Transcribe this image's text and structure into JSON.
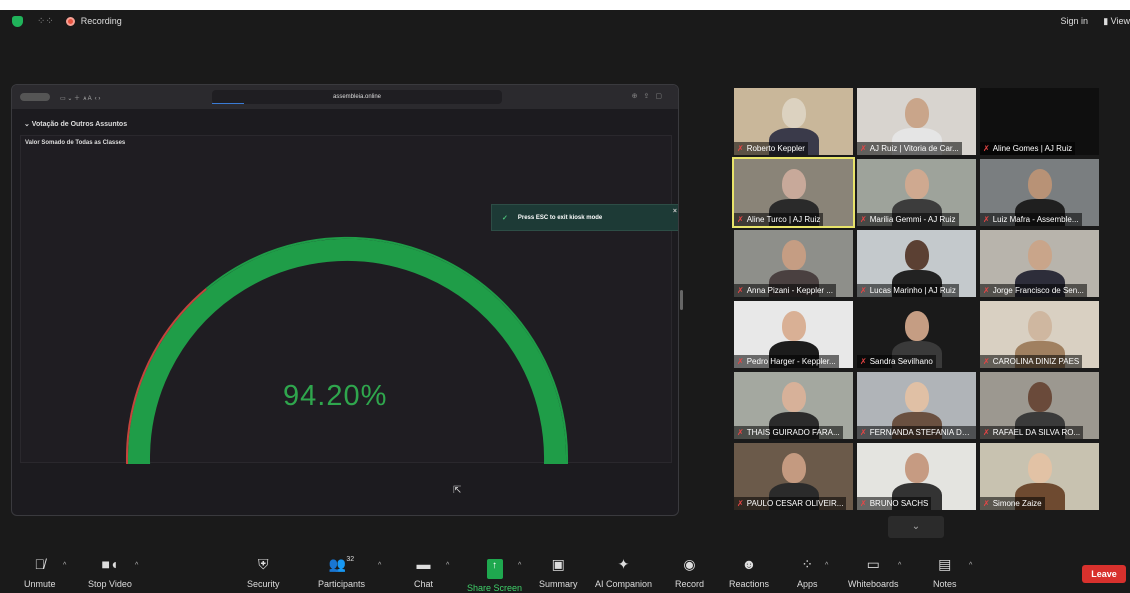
{
  "top": {
    "recording_label": "Recording",
    "sign_in": "Sign in",
    "view": "View"
  },
  "browser": {
    "url": "assembleia.online"
  },
  "share": {
    "section_title": "⌄ Votação de Outros Assuntos",
    "panel_title": "Valor Somado de Todas as Classes",
    "gauge_value_text": "94.20%",
    "gauge_fraction": 0.942,
    "gauge_green": "#1f9d48",
    "gauge_red": "#c5443c",
    "toast_text": "Press ESC to exit kiosk mode"
  },
  "participants": [
    {
      "name": "Roberto Keppler"
    },
    {
      "name": "AJ Ruiz | Vitoria de Car..."
    },
    {
      "name": "Aline Gomes | AJ Ruiz"
    },
    {
      "name": "Aline Turco | AJ Ruiz"
    },
    {
      "name": "Marilia Gemmi - AJ Ruiz"
    },
    {
      "name": "Luiz Mafra - Assemble..."
    },
    {
      "name": "Anna Pizani - Keppler ..."
    },
    {
      "name": "Lucas Marinho | AJ Ruiz"
    },
    {
      "name": "Jorge Francisco de Sen..."
    },
    {
      "name": "Pedro Harger - Keppler..."
    },
    {
      "name": "Sandra Sevilhano"
    },
    {
      "name": "CAROLINA DINIZ PAES"
    },
    {
      "name": "THAIS GUIRADO FARA..."
    },
    {
      "name": "FERNANDA STEFANIA DE..."
    },
    {
      "name": "RAFAEL DA SILVA RO..."
    },
    {
      "name": "PAULO CESAR OLIVEIR..."
    },
    {
      "name": "BRUNO SACHS"
    },
    {
      "name": "Simone Zaize"
    }
  ],
  "toolbar": {
    "unmute": "Unmute",
    "stop_video": "Stop Video",
    "security": "Security",
    "participants": "Participants",
    "participants_count": "32",
    "chat": "Chat",
    "share_screen": "Share Screen",
    "summary": "Summary",
    "ai_companion": "AI Companion",
    "record": "Record",
    "reactions": "Reactions",
    "apps": "Apps",
    "whiteboards": "Whiteboards",
    "notes": "Notes",
    "leave": "Leave"
  }
}
